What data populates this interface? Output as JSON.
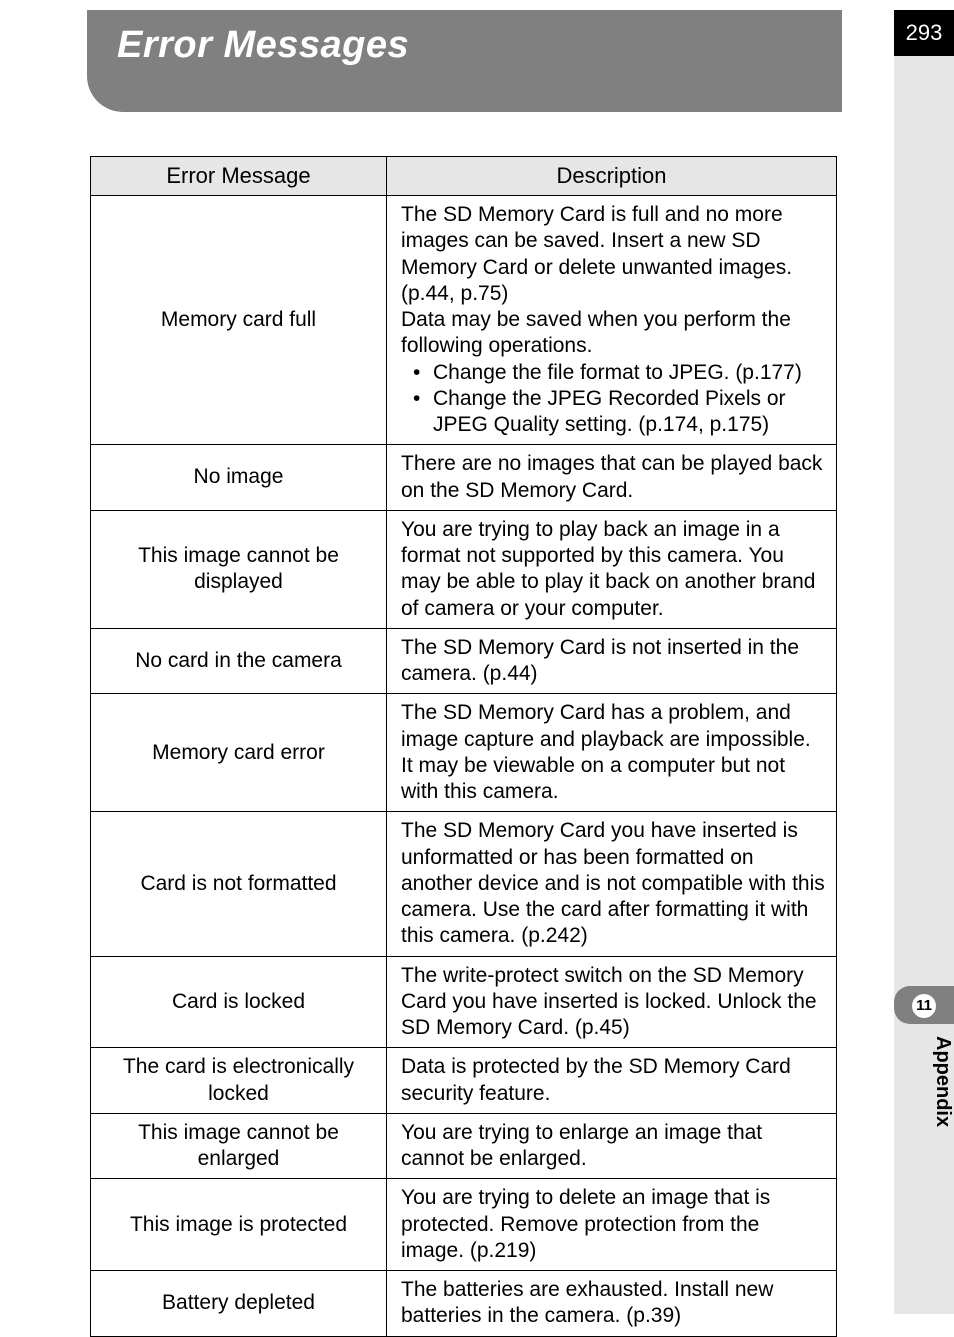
{
  "page": {
    "title": "Error Messages",
    "page_number": "293",
    "chapter_number": "11",
    "chapter_label": "Appendix"
  },
  "table": {
    "headers": {
      "col1": "Error Message",
      "col2": "Description"
    },
    "rows": [
      {
        "msg": "Memory card full",
        "desc_pre": "The SD Memory Card is full and no more images can be saved. Insert a new SD Memory Card or delete unwanted images. (p.44, p.75)\nData may be saved when you perform the following operations.",
        "bullets": [
          "Change the file format to JPEG. (p.177)",
          "Change the JPEG Recorded Pixels or JPEG Quality setting. (p.174, p.175)"
        ]
      },
      {
        "msg": "No image",
        "desc": "There are no images that can be played back on the SD Memory Card."
      },
      {
        "msg": "This image cannot be displayed",
        "desc": "You are trying to play back an image in a format not supported by this camera. You may be able to play it back on another brand of camera or your computer."
      },
      {
        "msg": "No card in the camera",
        "desc": "The SD Memory Card is not inserted in the camera. (p.44)"
      },
      {
        "msg": "Memory card error",
        "desc": "The SD Memory Card has a problem, and image capture and playback are impossible. It may be viewable on a computer but not with this camera."
      },
      {
        "msg": "Card is not formatted",
        "desc": "The SD Memory Card you have inserted is unformatted or has been formatted on another device and is not compatible with this camera. Use the card after formatting it with this camera. (p.242)"
      },
      {
        "msg": "Card is locked",
        "desc": "The write-protect switch on the SD Memory Card you have inserted is locked. Unlock the SD Memory Card. (p.45)"
      },
      {
        "msg": "The card is electronically locked",
        "desc": "Data is protected by the SD Memory Card security feature."
      },
      {
        "msg": "This image cannot be enlarged",
        "desc": "You are trying to enlarge an image that cannot be enlarged."
      },
      {
        "msg": "This image is protected",
        "desc": "You are trying to delete an image that is protected. Remove protection from the image. (p.219)"
      },
      {
        "msg": "Battery depleted",
        "desc": "The batteries are exhausted. Install new batteries in the camera. (p.39)"
      }
    ]
  }
}
